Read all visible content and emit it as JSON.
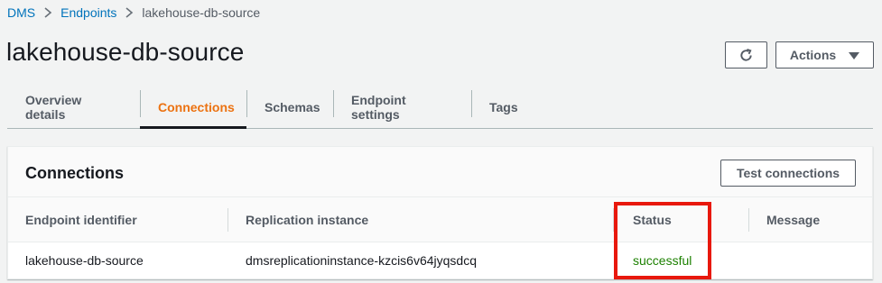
{
  "breadcrumb": {
    "items": [
      "DMS",
      "Endpoints",
      "lakehouse-db-source"
    ]
  },
  "header": {
    "title": "lakehouse-db-source",
    "actions_label": "Actions"
  },
  "tabs": [
    {
      "label": "Overview details",
      "active": false
    },
    {
      "label": "Connections",
      "active": true
    },
    {
      "label": "Schemas",
      "active": false
    },
    {
      "label": "Endpoint settings",
      "active": false
    },
    {
      "label": "Tags",
      "active": false
    }
  ],
  "connections": {
    "title": "Connections",
    "test_button": "Test connections",
    "columns": [
      "Endpoint identifier",
      "Replication instance",
      "Status",
      "Message"
    ],
    "rows": [
      {
        "endpoint_identifier": "lakehouse-db-source",
        "replication_instance": "dmsreplicationinstance-kzcis6v64jyqsdcq",
        "status": "successful",
        "message": ""
      }
    ]
  },
  "colors": {
    "link": "#0073bb",
    "active_tab": "#ec7211",
    "status_success": "#1d8102",
    "highlight": "#e8180d"
  },
  "icons": [
    "chevron-right-icon",
    "refresh-icon",
    "caret-down-icon"
  ]
}
